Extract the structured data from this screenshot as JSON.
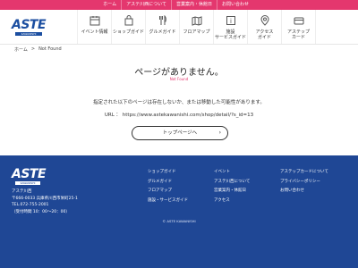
{
  "topbar": {
    "links": [
      "ホーム",
      "アステ川西について",
      "営業案内・休館日",
      "お問い合わせ"
    ]
  },
  "header": {
    "logo_text": "ASTE",
    "logo_sub": "KAWANISHI",
    "nav": [
      {
        "label": "イベント情報",
        "icon": "calendar-icon"
      },
      {
        "label": "ショップガイド",
        "icon": "shop-icon"
      },
      {
        "label": "グルメガイド",
        "icon": "dining-icon"
      },
      {
        "label": "フロアマップ",
        "icon": "map-icon"
      },
      {
        "label": "施設\nサービスガイド",
        "icon": "info-icon"
      },
      {
        "label": "アクセス\nガイド",
        "icon": "location-pin-icon"
      },
      {
        "label": "アステップ\nカード",
        "icon": "card-icon"
      }
    ]
  },
  "breadcrumb": {
    "home": "ホーム",
    "sep": ">",
    "current": "Not Found"
  },
  "main": {
    "title": "ページがありません。",
    "subtitle": "Not Found",
    "message": "指定された以下のページは存在しないか、または移動した可能性があります。",
    "url_label": "URL ：",
    "url": "https://www.astekawanishi.com/shop/detail/?s_id=13",
    "top_button": "トップページへ"
  },
  "footer": {
    "logo_text": "ASTE",
    "logo_sub": "KAWANISHI",
    "name": "アステ川西",
    "address": "〒666-0033 兵庫県川西市栄町25-1",
    "tel": "TEL.072-755-2001",
    "hours": "（受付時間 10：00～20：00）",
    "col1": [
      "ショップガイド",
      "グルメガイド",
      "フロアマップ",
      "施設・サービスガイド"
    ],
    "col2": [
      "イベント",
      "アステ川西について",
      "営業案内・休館日",
      "アクセス"
    ],
    "col3": [
      "アステップカードについて",
      "プライバシーポリシー",
      "お問い合わせ"
    ],
    "copyright": "© ASTE KAWANISHI"
  },
  "colors": {
    "accent": "#e4376e",
    "brand": "#1f4795"
  }
}
